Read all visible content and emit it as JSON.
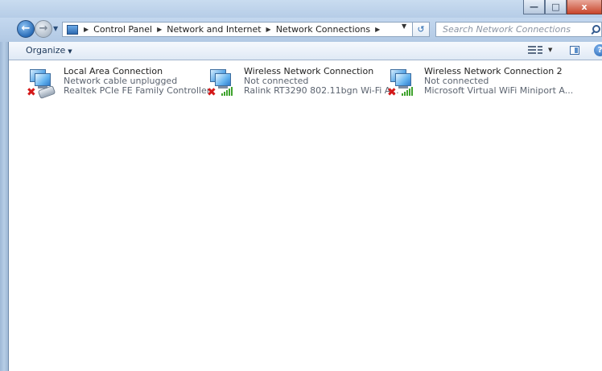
{
  "window": {
    "minimize": "—",
    "maximize": "□",
    "close": "x"
  },
  "address_bar": {
    "breadcrumbs": [
      "Control Panel",
      "Network and Internet",
      "Network Connections"
    ],
    "search_placeholder": "Search Network Connections"
  },
  "toolbar": {
    "organize_label": "Organize",
    "help_label": "?"
  },
  "connections": [
    {
      "name": "Local Area Connection",
      "status": "Network cable unplugged",
      "device": "Realtek PCIe FE Family Controller",
      "type_icon": "ethernet-cable-icon"
    },
    {
      "name": "Wireless Network Connection",
      "status": "Not connected",
      "device": "Ralink RT3290 802.11bgn Wi-Fi A...",
      "type_icon": "wifi-signal-icon"
    },
    {
      "name": "Wireless Network Connection 2",
      "status": "Not connected",
      "device": "Microsoft Virtual WiFi Miniport A...",
      "type_icon": "wifi-signal-icon"
    }
  ],
  "colors": {
    "disconnected": "#d41818",
    "signal": "#3fa32d",
    "frame": "#b4cbe6"
  }
}
